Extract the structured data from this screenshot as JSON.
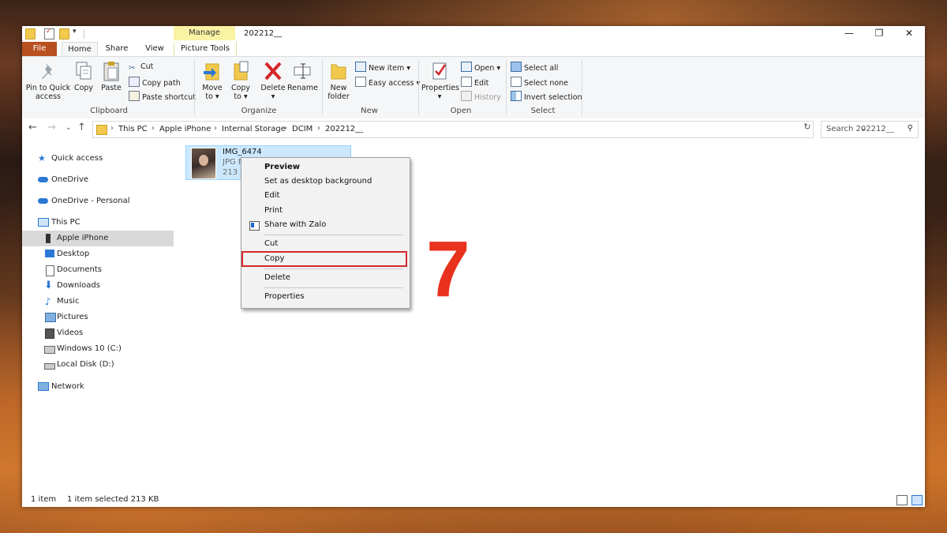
{
  "window": {
    "title": "202212__",
    "minimize": "—",
    "maximize": "❐",
    "close": "✕"
  },
  "ribbon_tabs": {
    "file": "File",
    "home": "Home",
    "share": "Share",
    "view": "View",
    "context_header": "Manage",
    "picture_tools": "Picture Tools"
  },
  "ribbon": {
    "clipboard": {
      "label": "Clipboard",
      "pin": "Pin to Quick",
      "pin2": "access",
      "copy": "Copy",
      "paste": "Paste",
      "cut": "Cut",
      "copy_path": "Copy path",
      "paste_shortcut": "Paste shortcut"
    },
    "organize": {
      "label": "Organize",
      "move_to": "Move",
      "move_to2": "to ▾",
      "copy_to": "Copy",
      "copy_to2": "to ▾",
      "delete": "Delete",
      "delete2": "▾",
      "rename": "Rename"
    },
    "new": {
      "label": "New",
      "new_folder": "New",
      "new_folder2": "folder",
      "new_item": "New item ▾",
      "easy_access": "Easy access ▾"
    },
    "open": {
      "label": "Open",
      "properties": "Properties",
      "properties2": "▾",
      "open": "Open ▾",
      "edit": "Edit",
      "history": "History"
    },
    "select": {
      "label": "Select",
      "select_all": "Select all",
      "select_none": "Select none",
      "invert": "Invert selection"
    }
  },
  "address": {
    "crumbs": [
      "This PC",
      "Apple iPhone",
      "Internal Storage",
      "DCIM",
      "202212__"
    ],
    "separator": "›",
    "search_placeholder": "Search 202212__"
  },
  "sidebar": {
    "items": [
      {
        "label": "Quick access"
      },
      {
        "label": "OneDrive"
      },
      {
        "label": "OneDrive - Personal"
      },
      {
        "label": "This PC"
      },
      {
        "label": "Apple iPhone"
      },
      {
        "label": "Desktop"
      },
      {
        "label": "Documents"
      },
      {
        "label": "Downloads"
      },
      {
        "label": "Music"
      },
      {
        "label": "Pictures"
      },
      {
        "label": "Videos"
      },
      {
        "label": "Windows 10 (C:)"
      },
      {
        "label": "Local Disk (D:)"
      },
      {
        "label": "Network"
      }
    ]
  },
  "file": {
    "name": "IMG_6474",
    "type": "JPG F",
    "size": "213 K"
  },
  "context_menu": {
    "items": [
      "Preview",
      "Set as desktop background",
      "Edit",
      "Print",
      "Share with Zalo",
      "Cut",
      "Copy",
      "Delete",
      "Properties"
    ]
  },
  "step_number": "7",
  "status": {
    "count": "1 item",
    "selected": "1 item selected  213 KB"
  },
  "colors": {
    "file_tab": "#b84f1e",
    "highlight_box": "#d6262a",
    "step_number": "#e8321e",
    "selection": "#cce8ff"
  }
}
